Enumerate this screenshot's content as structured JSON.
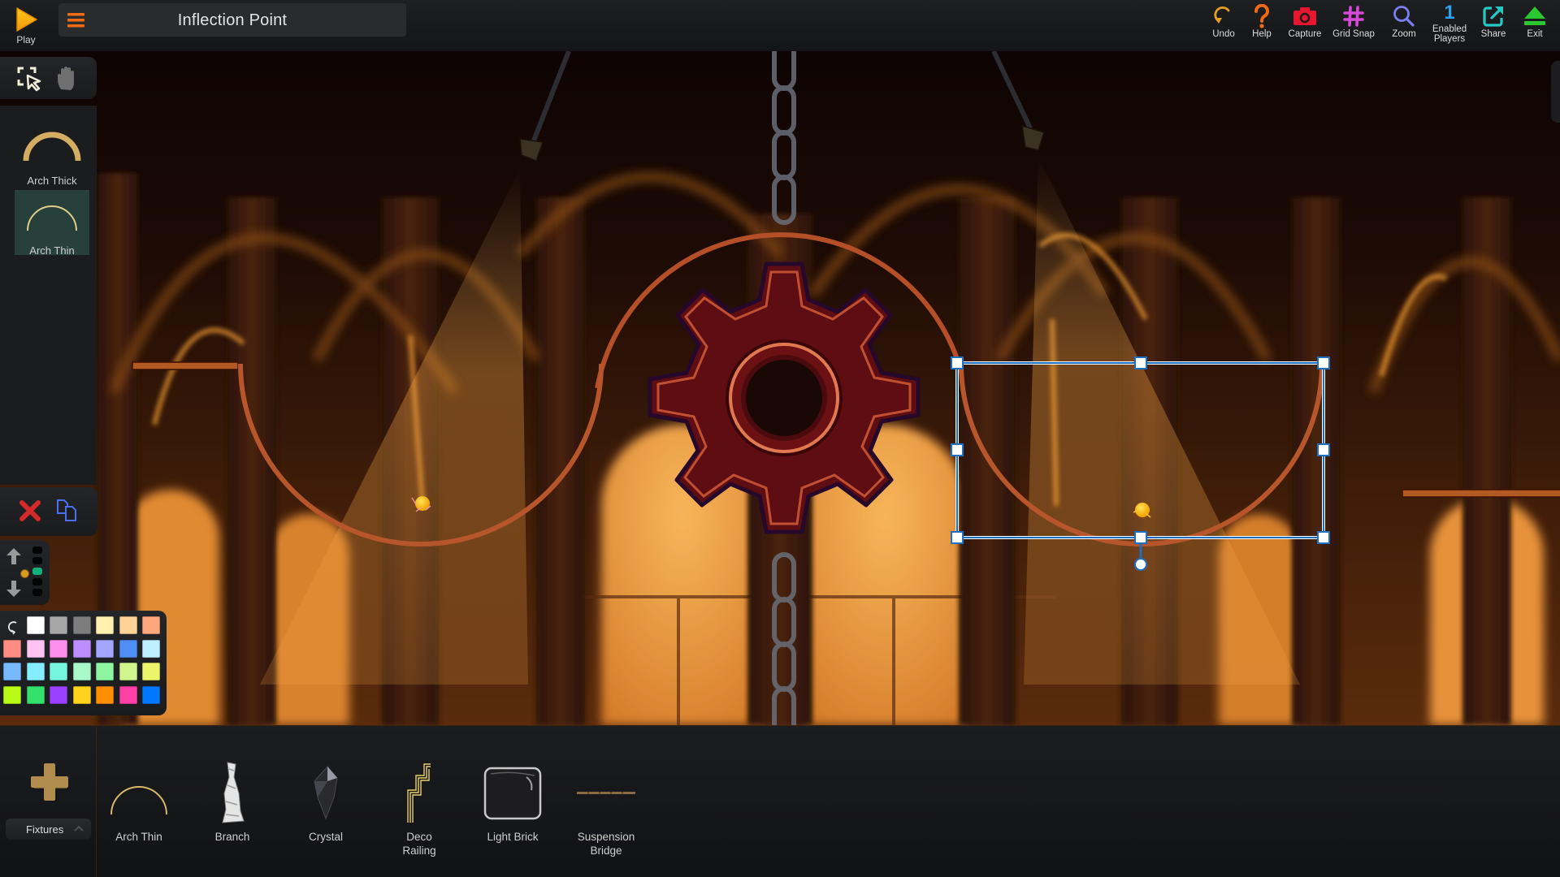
{
  "app": {
    "play_label": "Play",
    "level_title": "Inflection Point"
  },
  "toolbar": [
    {
      "id": "undo",
      "label": "Undo",
      "icon": "undo-icon",
      "color": "#e3a020"
    },
    {
      "id": "help",
      "label": "Help",
      "icon": "question-icon",
      "color": "#ee6a16"
    },
    {
      "id": "capture",
      "label": "Capture",
      "icon": "camera-icon",
      "color": "#e5162e"
    },
    {
      "id": "grid-snap",
      "label": "Grid Snap",
      "icon": "grid-hash-icon",
      "color": "#d64ad8"
    },
    {
      "id": "zoom",
      "label": "Zoom",
      "icon": "magnifier-icon",
      "color": "#7a7ff0"
    },
    {
      "id": "enabled-players",
      "label": "Enabled Players",
      "label_line1": "Enabled",
      "label_line2": "Players",
      "value": "1",
      "color": "#2aa0f0"
    },
    {
      "id": "share",
      "label": "Share",
      "icon": "share-icon",
      "color": "#25c9c6"
    },
    {
      "id": "exit",
      "label": "Exit",
      "icon": "eject-icon",
      "color": "#2bc832"
    }
  ],
  "left_panel": {
    "tools": [
      {
        "id": "select",
        "icon": "marquee-select-icon",
        "active": true
      },
      {
        "id": "pan",
        "icon": "hand-icon",
        "active": false
      }
    ],
    "shapes": [
      {
        "label": "Arch Thick",
        "active": false
      },
      {
        "label": "Arch Thin",
        "active": true
      }
    ],
    "actions": [
      {
        "id": "delete",
        "icon": "delete-x-icon",
        "color": "#d42a2a"
      },
      {
        "id": "duplicate",
        "icon": "duplicate-icon",
        "color": "#4a6ef0"
      }
    ],
    "layers": {
      "count": 5,
      "active_index": 2,
      "active_color": "#14b07a"
    },
    "palette": {
      "reset_icon": "reset-color-icon",
      "colors": [
        "#ffffff",
        "#a7a7a7",
        "#7d7d7d",
        "#fff0b0",
        "#ffd296",
        "#ffa77c",
        "#ff8c84",
        "#ffc3f2",
        "#ff8fea",
        "#bd8cff",
        "#a2a6ff",
        "#4f8ef5",
        "#bff0ff",
        "#78b8ff",
        "#84ecff",
        "#75f5de",
        "#a8f8c8",
        "#8cf5a2",
        "#cff58c",
        "#eaf56a",
        "#b7fa15",
        "#32e06c",
        "#9b40ff",
        "#ffd21c",
        "#ff8f00",
        "#ff3fa5",
        "#0078ff"
      ]
    }
  },
  "fixtures_bar": {
    "category_label": "Fixtures",
    "add_icon": "plus-icon",
    "items": [
      {
        "label": "Arch Thin",
        "line1": "Arch Thin",
        "line2": ""
      },
      {
        "label": "Branch",
        "line1": "Branch",
        "line2": ""
      },
      {
        "label": "Crystal",
        "line1": "Crystal",
        "line2": ""
      },
      {
        "label": "Deco Railing",
        "line1": "Deco",
        "line2": "Railing"
      },
      {
        "label": "Light Brick",
        "line1": "Light Brick",
        "line2": ""
      },
      {
        "label": "Suspension Bridge",
        "line1": "Suspension",
        "line2": "Bridge"
      }
    ]
  },
  "scene": {
    "selection": {
      "object": "Arch Thin",
      "handles": 8,
      "rotation_handle": true,
      "color": "#1e6fc0"
    },
    "objects": [
      "lamp-left",
      "lamp-right",
      "chain",
      "gear",
      "arch-ring-top",
      "bowl-left",
      "bowl-right-selected",
      "ledge-left",
      "ledge-right",
      "ball-left",
      "ball-right"
    ]
  }
}
